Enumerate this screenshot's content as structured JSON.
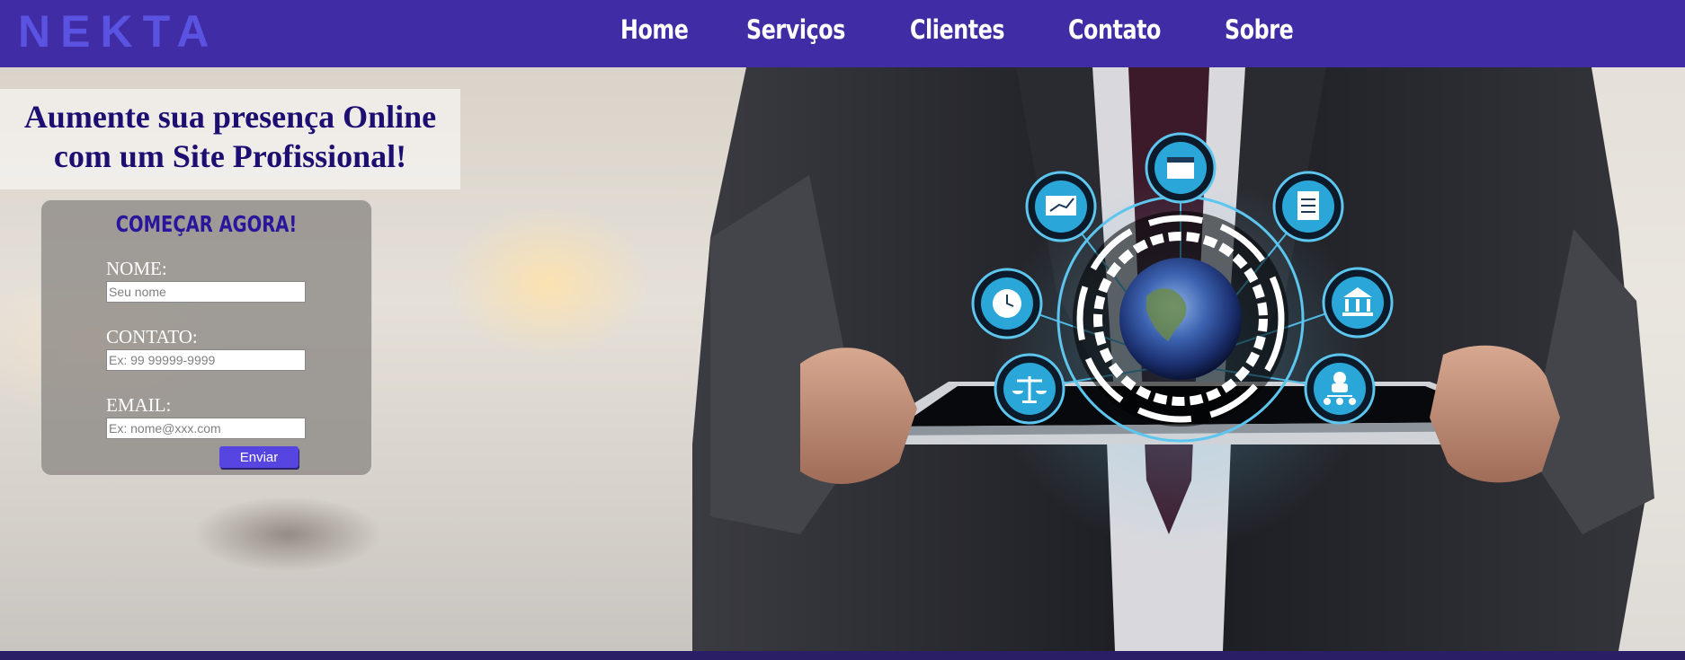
{
  "brand": {
    "logo_text": "NEKTA",
    "logo_color": "#5a52e0",
    "header_bg": "#402da5"
  },
  "nav": {
    "items": [
      {
        "label": "Home"
      },
      {
        "label": "Serviços"
      },
      {
        "label": "Clientes"
      },
      {
        "label": "Contato"
      },
      {
        "label": "Sobre"
      }
    ]
  },
  "hero": {
    "headline_line1": "Aumente sua presença Online",
    "headline_line2": "com um Site Profissional!",
    "headline_color": "#1d0e72",
    "image_description_icons": [
      "calendar-icon",
      "presentation-chart-icon",
      "document-icon",
      "clock-icon",
      "bank-icon",
      "scales-icon",
      "org-chart-icon",
      "globe-icon"
    ]
  },
  "form": {
    "title": "COMEÇAR AGORA!",
    "name_label": "NOME:",
    "name_placeholder": "Seu nome",
    "contact_label": "CONTATO:",
    "contact_placeholder": "Ex: 99 99999-9999",
    "email_label": "EMAIL:",
    "email_placeholder": "Ex: nome@xxx.com",
    "submit_label": "Enviar",
    "submit_color": "#5645e0"
  }
}
